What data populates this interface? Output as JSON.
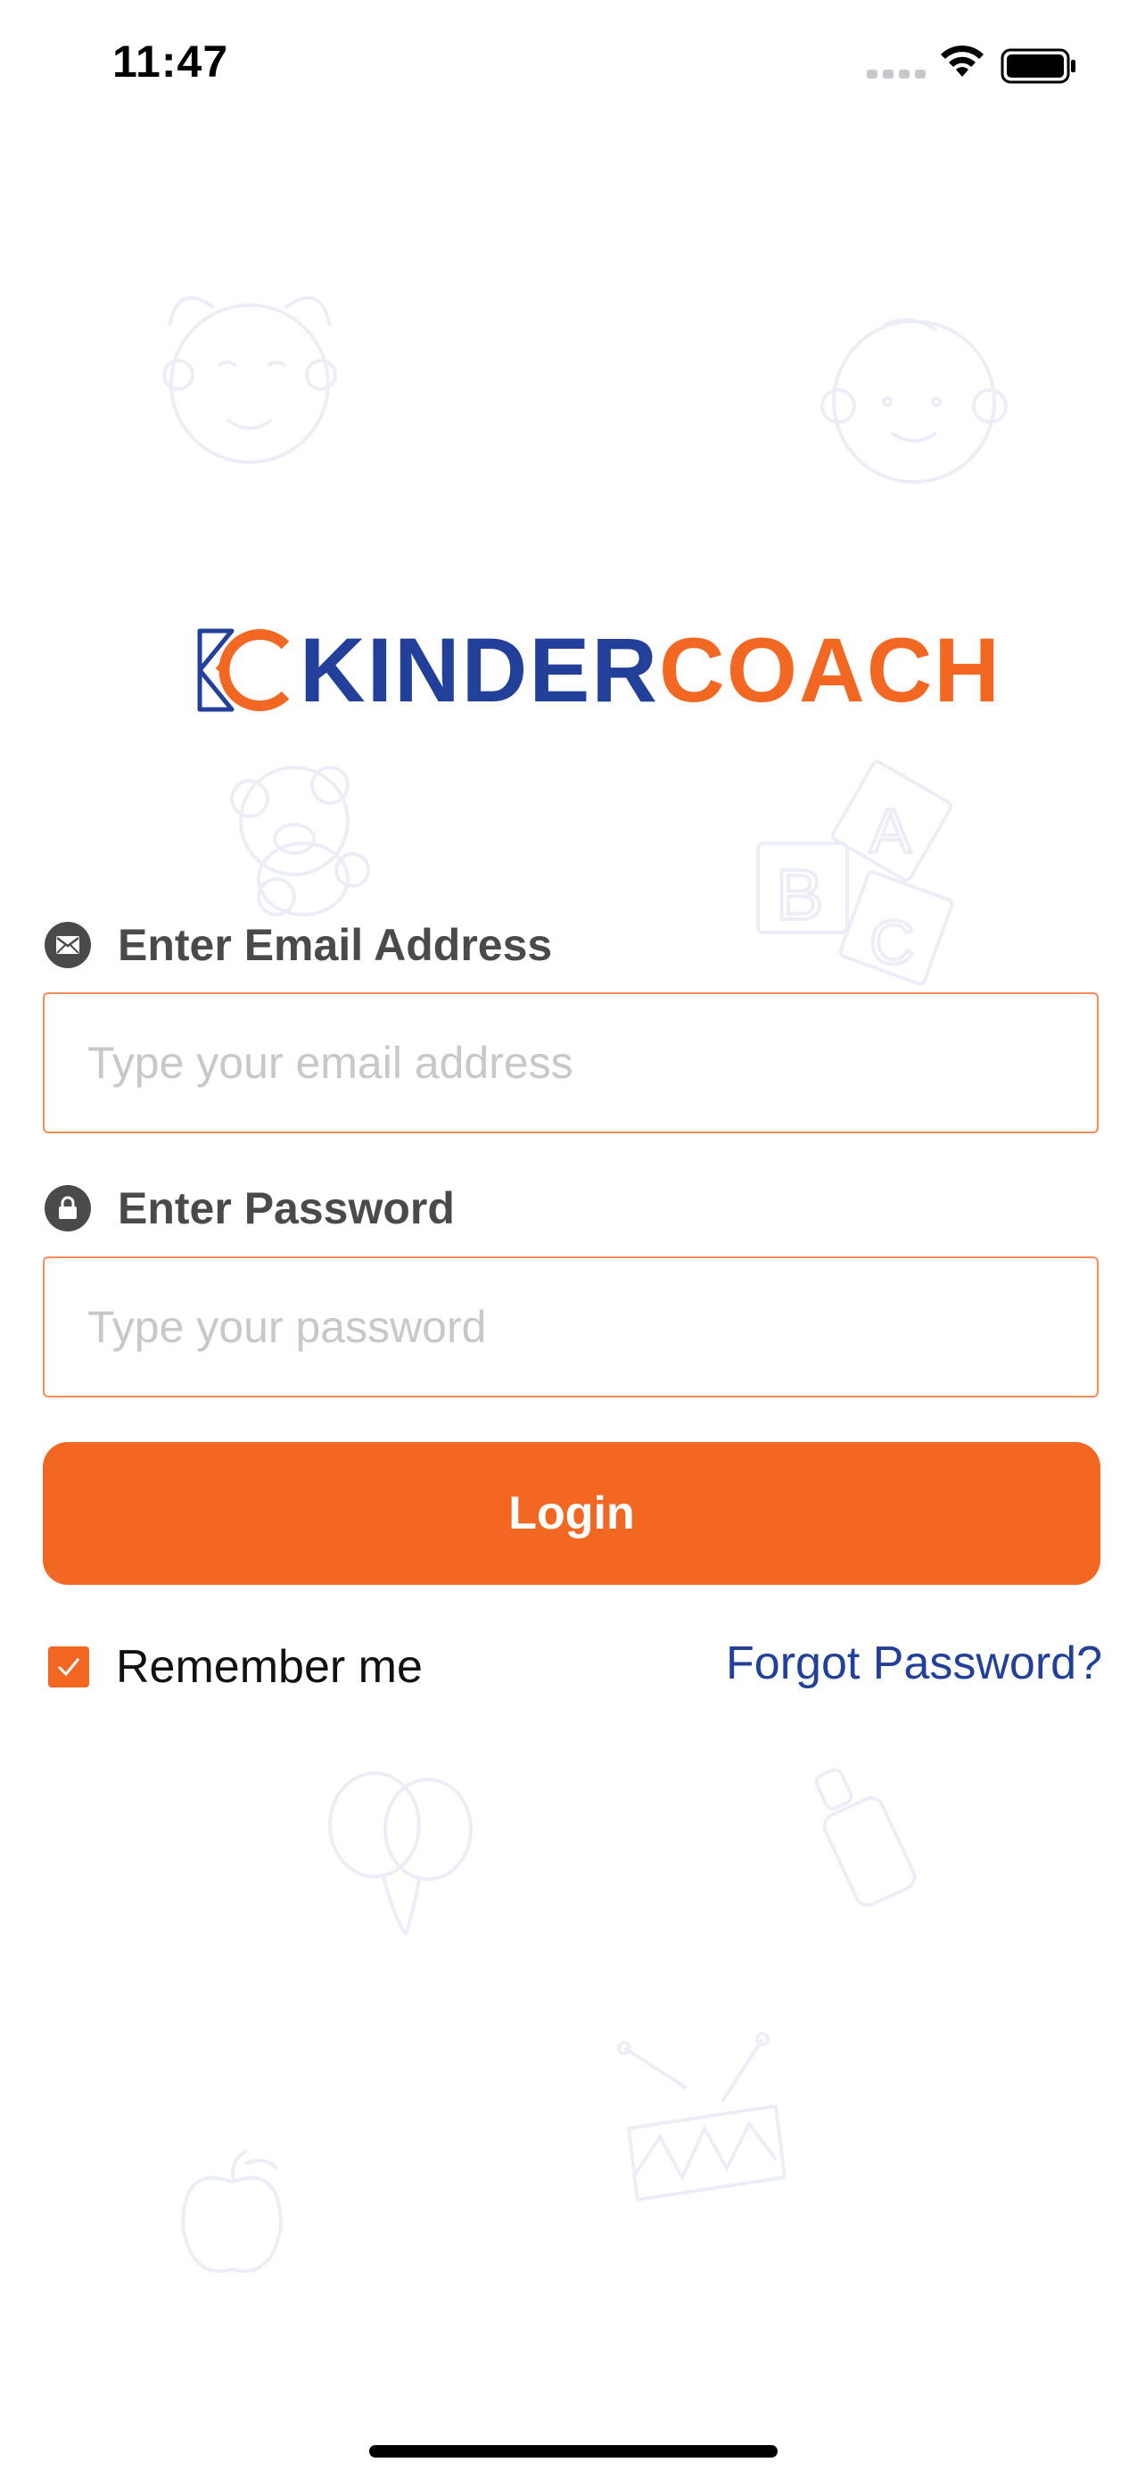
{
  "status_bar": {
    "time": "11:47"
  },
  "logo": {
    "part1": "KINDER",
    "part2": "COACH",
    "brand_blue": "#22409a",
    "brand_orange": "#f26722"
  },
  "email": {
    "label": "Enter Email Address",
    "placeholder": "Type your email address",
    "icon": "envelope-icon"
  },
  "password": {
    "label": "Enter Password",
    "placeholder": "Type your password",
    "icon": "lock-icon"
  },
  "login_button": {
    "label": "Login"
  },
  "remember_me": {
    "label": "Remember me",
    "checked": true
  },
  "forgot_password": {
    "label": "Forgot Password?"
  }
}
